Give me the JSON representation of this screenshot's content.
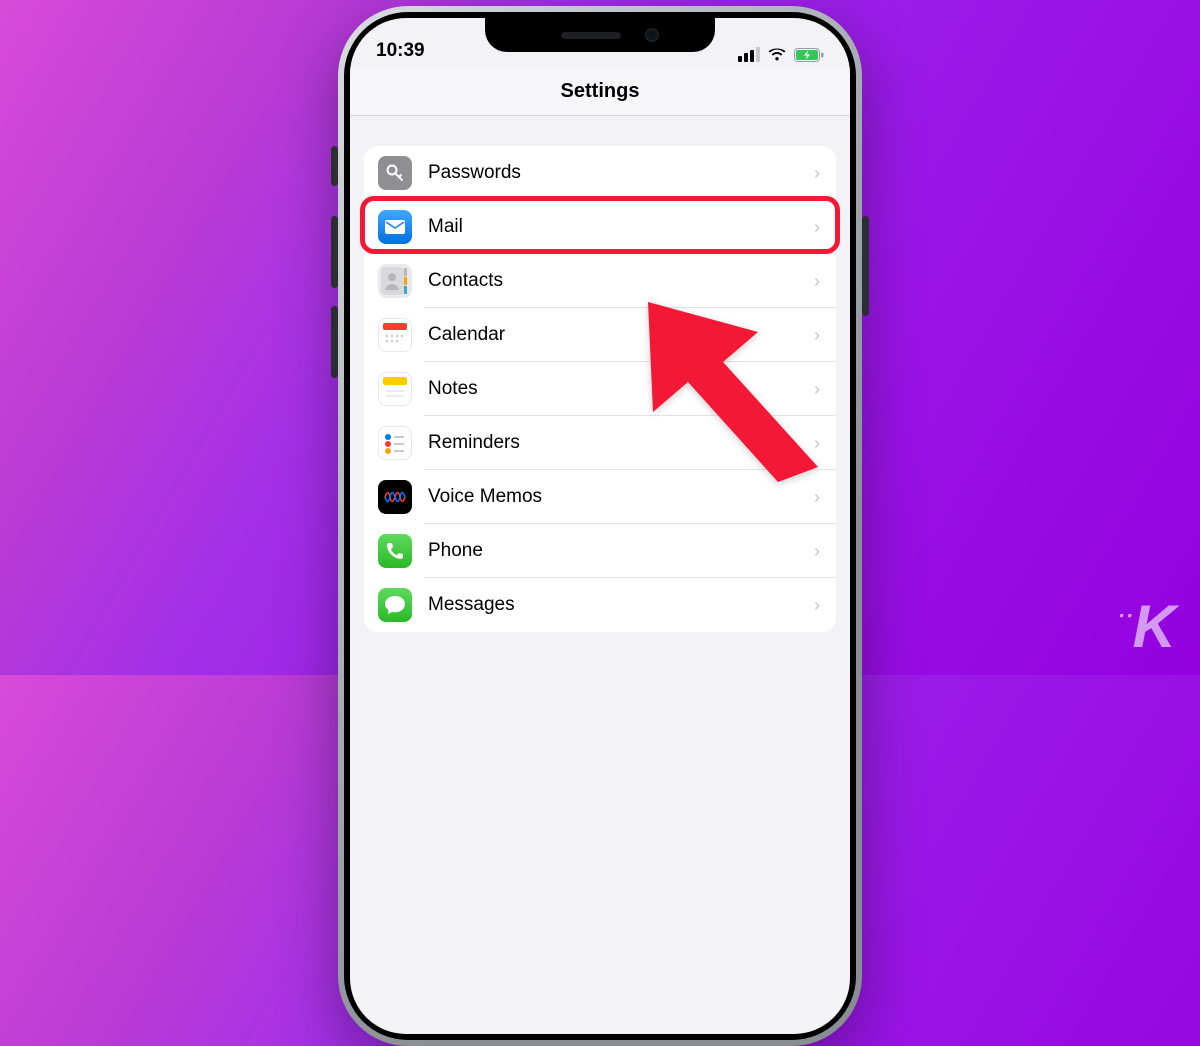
{
  "status": {
    "time": "10:39"
  },
  "header": {
    "title": "Settings"
  },
  "rows": [
    {
      "label": "Passwords",
      "icon": "key-icon"
    },
    {
      "label": "Mail",
      "icon": "mail-icon",
      "highlighted": true
    },
    {
      "label": "Contacts",
      "icon": "contacts-icon"
    },
    {
      "label": "Calendar",
      "icon": "calendar-icon"
    },
    {
      "label": "Notes",
      "icon": "notes-icon"
    },
    {
      "label": "Reminders",
      "icon": "reminders-icon"
    },
    {
      "label": "Voice Memos",
      "icon": "voicememos-icon"
    },
    {
      "label": "Phone",
      "icon": "phone-icon"
    },
    {
      "label": "Messages",
      "icon": "messages-icon"
    }
  ],
  "watermark": "K",
  "colors": {
    "highlight": "#f31836",
    "pointer": "#f31836"
  }
}
